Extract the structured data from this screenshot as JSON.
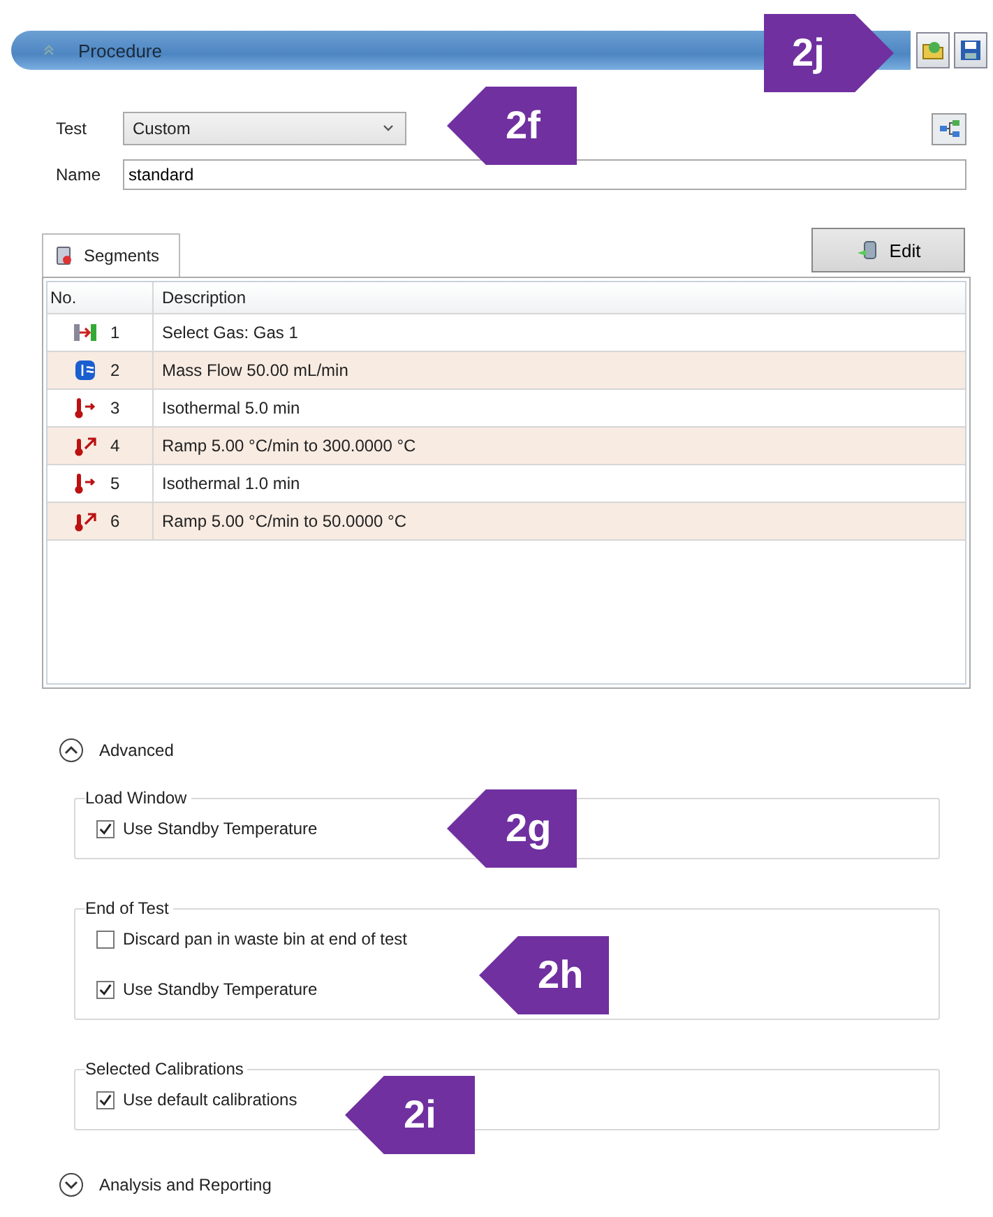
{
  "header": {
    "title": "Procedure"
  },
  "test": {
    "label": "Test",
    "value": "Custom"
  },
  "name": {
    "label": "Name",
    "value": "standard"
  },
  "tab": {
    "label": "Segments",
    "selected": true
  },
  "edit_button": "Edit",
  "table": {
    "columns": [
      "No.",
      "Description"
    ],
    "rows": [
      {
        "kind": "gas",
        "no": "1",
        "description": "Select Gas: Gas 1"
      },
      {
        "kind": "flow",
        "no": "2",
        "description": "Mass Flow  50.00 mL/min"
      },
      {
        "kind": "isothermal",
        "no": "3",
        "description": "Isothermal 5.0 min"
      },
      {
        "kind": "ramp",
        "no": "4",
        "description": "Ramp 5.00 °C/min to 300.0000 °C"
      },
      {
        "kind": "isothermal",
        "no": "5",
        "description": "Isothermal 1.0 min"
      },
      {
        "kind": "ramp",
        "no": "6",
        "description": "Ramp 5.00 °C/min to 50.0000 °C"
      }
    ]
  },
  "advanced": {
    "label": "Advanced",
    "expanded": true,
    "groups": [
      {
        "title": "Load Window",
        "options": [
          {
            "label": "Use Standby Temperature",
            "checked": true
          }
        ]
      },
      {
        "title": "End of Test",
        "options": [
          {
            "label": "Discard pan in waste bin at end of test",
            "checked": false
          },
          {
            "label": "Use Standby Temperature",
            "checked": true
          }
        ]
      },
      {
        "title": "Selected Calibrations",
        "options": [
          {
            "label": "Use default calibrations",
            "checked": true
          }
        ]
      }
    ]
  },
  "analysis": {
    "label": "Analysis and Reporting",
    "expanded": false
  },
  "callouts": [
    {
      "label": "2j",
      "kind": "right"
    },
    {
      "label": "2f",
      "kind": "left"
    },
    {
      "label": "2g",
      "kind": "left"
    },
    {
      "label": "2h",
      "kind": "left"
    },
    {
      "label": "2i",
      "kind": "left"
    }
  ]
}
